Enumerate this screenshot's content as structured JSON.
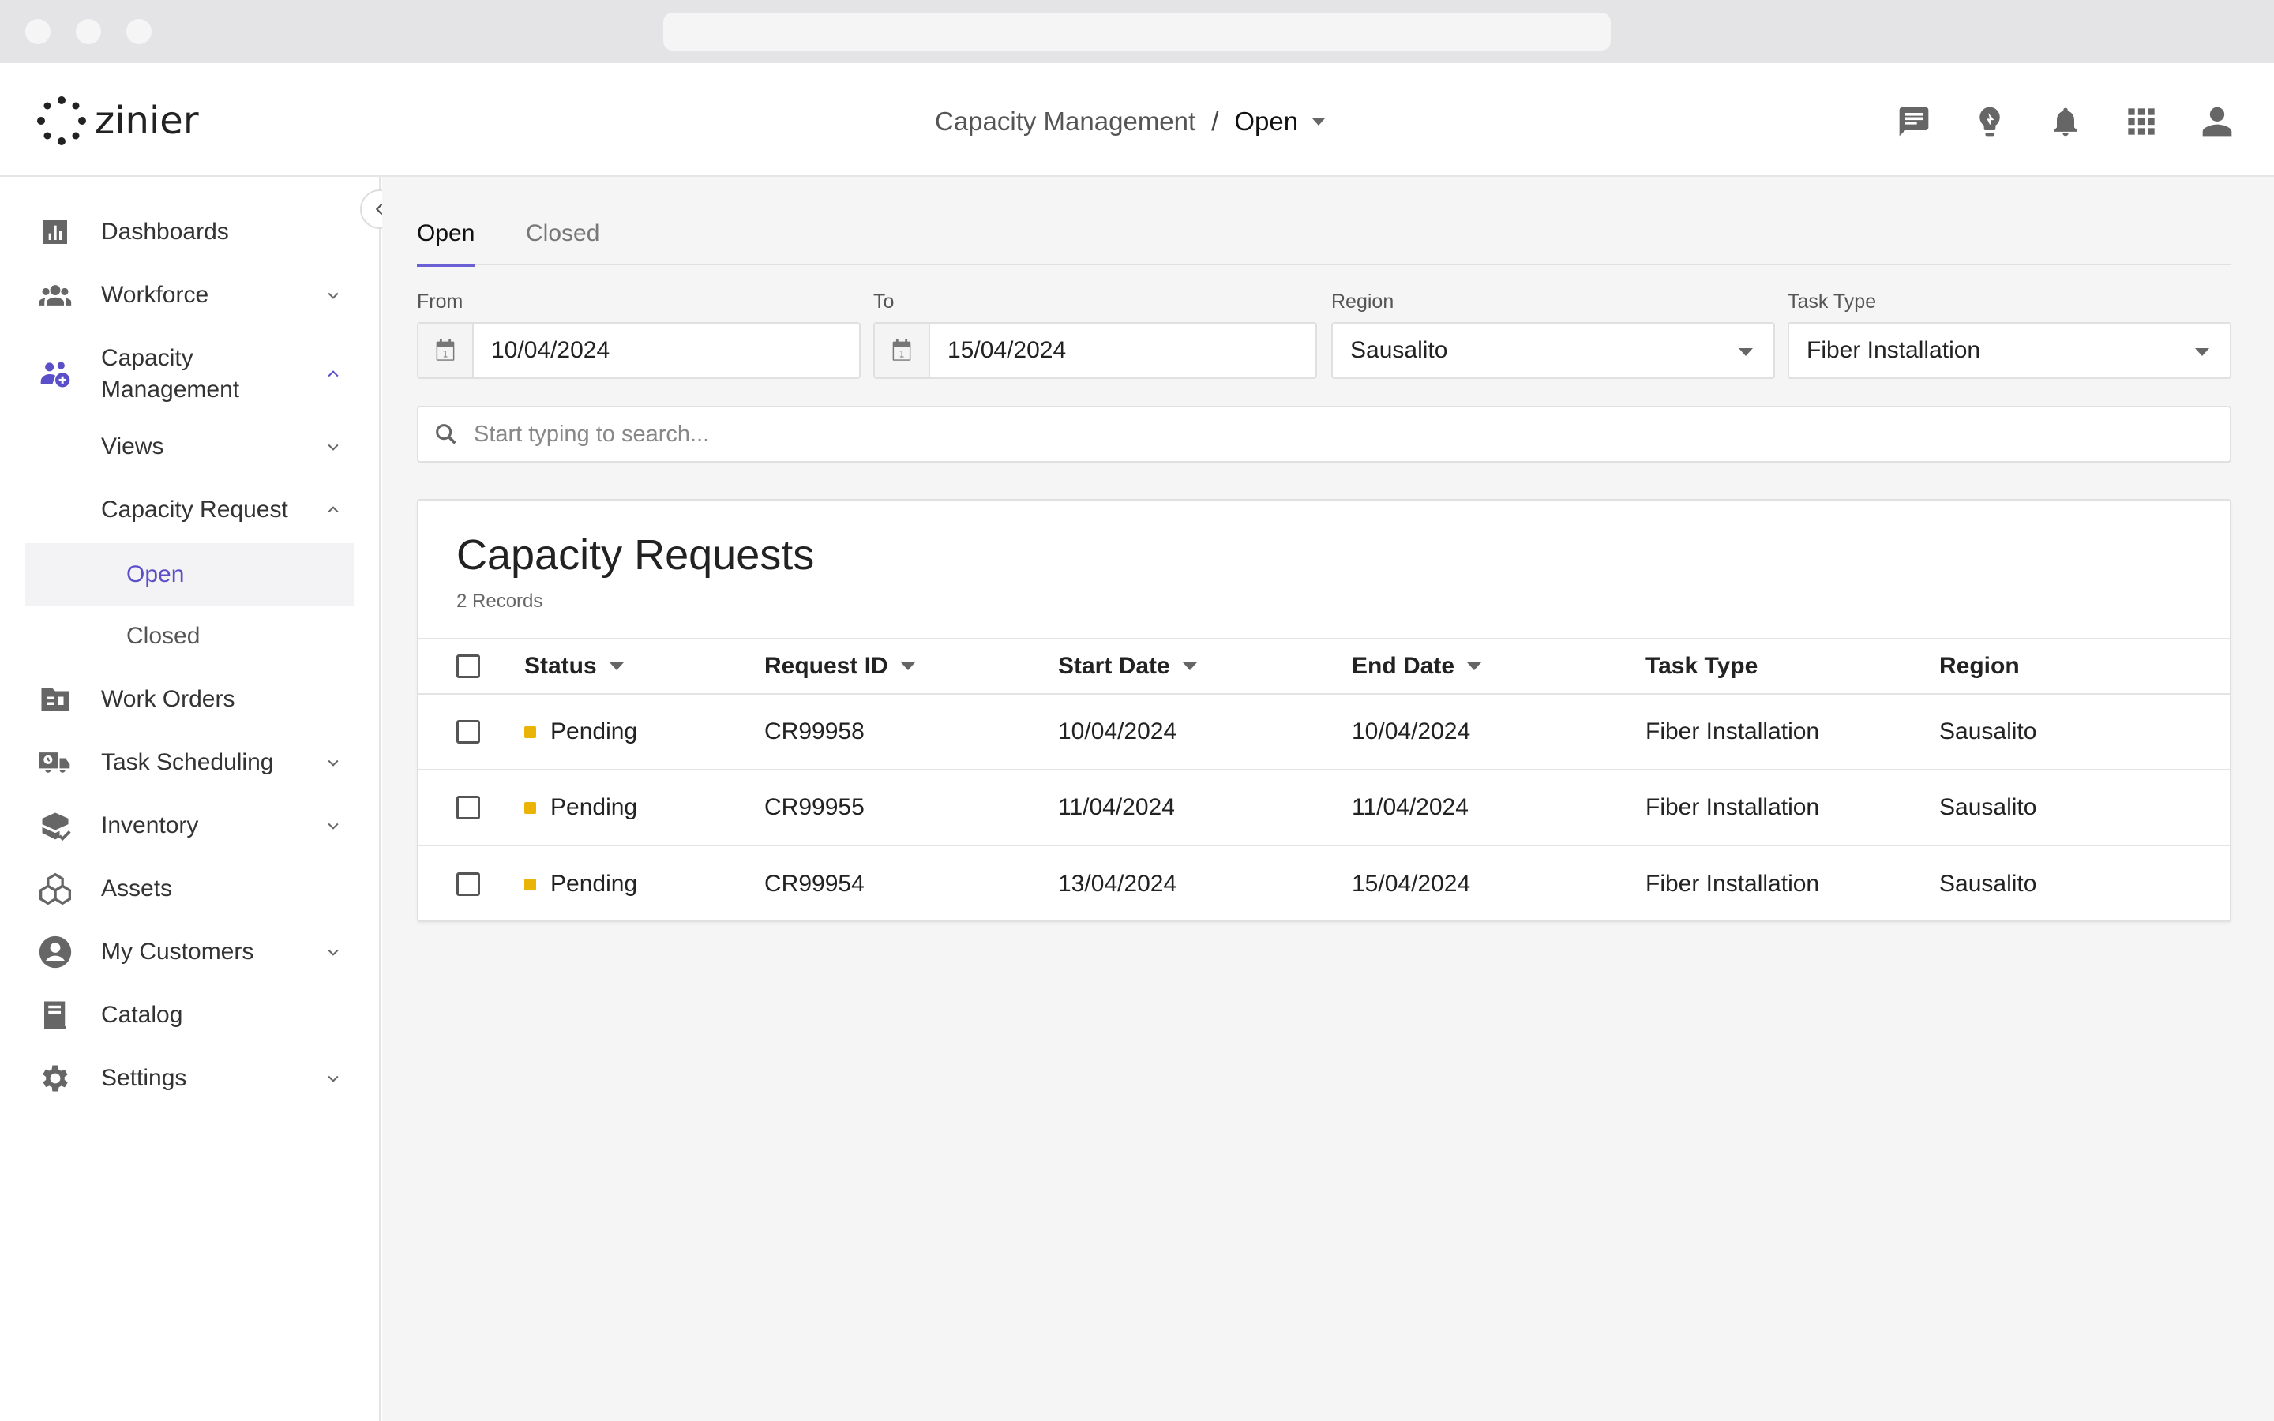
{
  "app": {
    "logo_text": "zinier"
  },
  "breadcrumb": {
    "parent": "Capacity Management",
    "separator": "/",
    "current": "Open"
  },
  "header_icons": [
    "chat-icon",
    "lightbulb-icon",
    "bell-icon",
    "apps-grid-icon",
    "user-icon"
  ],
  "sidebar": {
    "items": [
      {
        "label": "Dashboards",
        "icon": "bar-chart-icon"
      },
      {
        "label": "Workforce",
        "icon": "people-icon"
      },
      {
        "label": "Capacity Management",
        "icon": "capacity-icon"
      },
      {
        "label": "Views"
      },
      {
        "label": "Capacity Request"
      },
      {
        "label": "Open"
      },
      {
        "label": "Closed"
      },
      {
        "label": "Work Orders",
        "icon": "work-orders-icon"
      },
      {
        "label": "Task Scheduling",
        "icon": "truck-icon"
      },
      {
        "label": "Inventory",
        "icon": "inventory-icon"
      },
      {
        "label": "Assets",
        "icon": "assets-icon"
      },
      {
        "label": "My Customers",
        "icon": "customer-icon"
      },
      {
        "label": "Catalog",
        "icon": "catalog-icon"
      },
      {
        "label": "Settings",
        "icon": "gear-icon"
      }
    ]
  },
  "tabs": [
    {
      "label": "Open",
      "active": true
    },
    {
      "label": "Closed",
      "active": false
    }
  ],
  "filters": {
    "from": {
      "label": "From",
      "value": "10/04/2024"
    },
    "to": {
      "label": "To",
      "value": "15/04/2024"
    },
    "region": {
      "label": "Region",
      "value": "Sausalito"
    },
    "task_type": {
      "label": "Task Type",
      "value": "Fiber Installation"
    }
  },
  "search": {
    "placeholder": "Start typing to search..."
  },
  "table": {
    "title": "Capacity Requests",
    "record_count": "2 Records",
    "columns": [
      "Status",
      "Request ID",
      "Start Date",
      "End Date",
      "Task Type",
      "Region"
    ],
    "rows": [
      {
        "status": "Pending",
        "request_id": "CR99958",
        "start": "10/04/2024",
        "end": "10/04/2024",
        "task_type": "Fiber Installation",
        "region": "Sausalito"
      },
      {
        "status": "Pending",
        "request_id": "CR99955",
        "start": "11/04/2024",
        "end": "11/04/2024",
        "task_type": "Fiber Installation",
        "region": "Sausalito"
      },
      {
        "status": "Pending",
        "request_id": "CR99954",
        "start": "13/04/2024",
        "end": "15/04/2024",
        "task_type": "Fiber Installation",
        "region": "Sausalito"
      }
    ]
  },
  "colors": {
    "accent": "#5b4fc9",
    "pending": "#eab308"
  }
}
